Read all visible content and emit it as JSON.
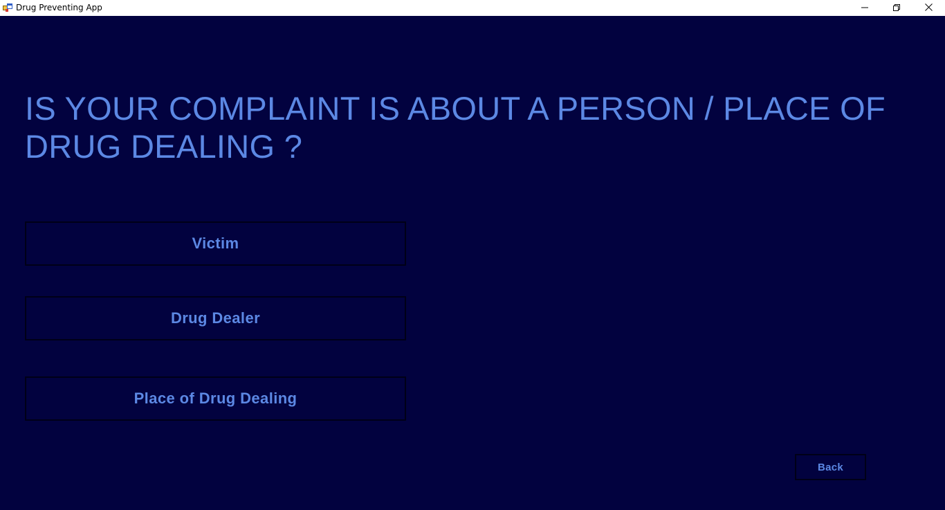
{
  "window": {
    "title": "Drug Preventing App",
    "icon": "windows-form-app-icon",
    "controls": {
      "minimize_icon": "minimize-icon",
      "restore_icon": "restore-icon",
      "close_icon": "close-icon"
    }
  },
  "main": {
    "question": "IS YOUR COMPLAINT IS ABOUT A PERSON / PLACE OF DRUG DEALING ?",
    "options": [
      {
        "label": "Victim"
      },
      {
        "label": "Drug Dealer"
      },
      {
        "label": "Place of Drug Dealing"
      }
    ],
    "back_label": "Back"
  },
  "colors": {
    "background": "#02023f",
    "text_accent": "#5c88e4",
    "button_border": "#000017",
    "titlebar": "#ffffff"
  }
}
